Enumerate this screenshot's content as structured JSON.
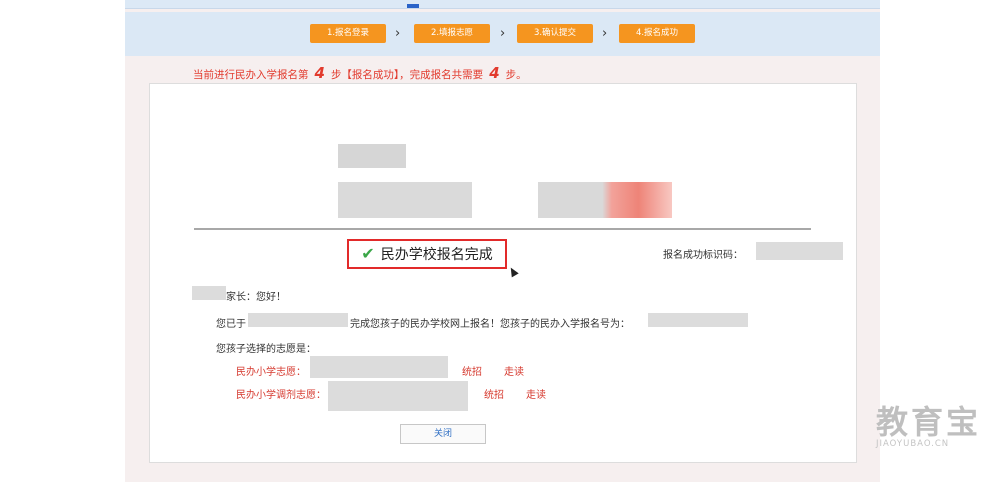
{
  "steps": [
    "1.报名登录",
    "2.填报志愿",
    "3.确认提交",
    "4.报名成功"
  ],
  "arrow": "›",
  "progress": {
    "prefix": "当前进行民办入学报名第",
    "current_step": "4",
    "middle": "步【报名成功】，完成报名共需要",
    "total_steps": "4",
    "suffix": "步。"
  },
  "result": {
    "success_text": "民办学校报名完成",
    "id_label": "报名成功标识码："
  },
  "letter": {
    "greeting": "家长：您好！",
    "line1_a": "您已于",
    "line1_b": "完成您孩子的民办学校网上报名！您孩子的民办入学报名号为：",
    "choices_label": "您孩子选择的志愿是：",
    "primary_label": "民办小学志愿：",
    "adjust_label": "民办小学调剂志愿：",
    "option_a": "统招",
    "option_b": "走读"
  },
  "close_button": "关闭",
  "watermark": {
    "main": "教育宝",
    "sub": "JIAOYUBAO.CN"
  },
  "colors": {
    "step_orange": "#f5951f",
    "alert_red": "#e23a2d",
    "success_green": "#3aa648",
    "highlight_border": "#e22a2a"
  }
}
